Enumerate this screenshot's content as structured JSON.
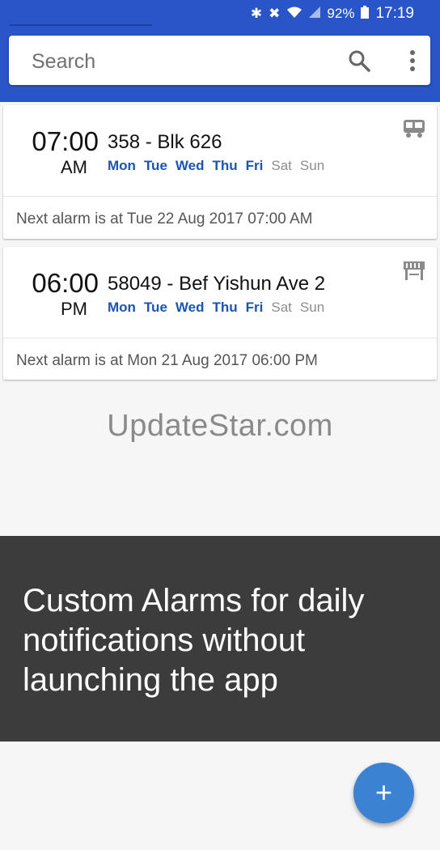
{
  "status_bar": {
    "icons": [
      "bluetooth-icon",
      "mute-icon",
      "wifi-icon",
      "signal-icon",
      "battery-icon"
    ],
    "battery_percent": "92%",
    "time": "17:19"
  },
  "search": {
    "placeholder": "Search"
  },
  "alarms": [
    {
      "time": "07:00",
      "ampm": "AM",
      "title": "358 - Blk 626",
      "days": [
        {
          "label": "Mon",
          "active": true
        },
        {
          "label": "Tue",
          "active": true
        },
        {
          "label": "Wed",
          "active": true
        },
        {
          "label": "Thu",
          "active": true
        },
        {
          "label": "Fri",
          "active": true
        },
        {
          "label": "Sat",
          "active": false
        },
        {
          "label": "Sun",
          "active": false
        }
      ],
      "icon": "bus-icon",
      "next": "Next alarm is at Tue 22 Aug 2017 07:00 AM"
    },
    {
      "time": "06:00",
      "ampm": "PM",
      "title": "58049 - Bef Yishun Ave 2",
      "days": [
        {
          "label": "Mon",
          "active": true
        },
        {
          "label": "Tue",
          "active": true
        },
        {
          "label": "Wed",
          "active": true
        },
        {
          "label": "Thu",
          "active": true
        },
        {
          "label": "Fri",
          "active": true
        },
        {
          "label": "Sat",
          "active": false
        },
        {
          "label": "Sun",
          "active": false
        }
      ],
      "icon": "bus-stop-icon",
      "next": "Next alarm is at Mon 21 Aug 2017 06:00 PM"
    }
  ],
  "watermark": "UpdateStar.com",
  "banner": {
    "text": "Custom Alarms for daily notifications without launching the app"
  },
  "fab": {
    "label": "+"
  },
  "colors": {
    "app_bar": "#2a55c8",
    "active_day": "#1a55b0",
    "fab": "#3b82d2",
    "banner": "#3c3c3c"
  }
}
